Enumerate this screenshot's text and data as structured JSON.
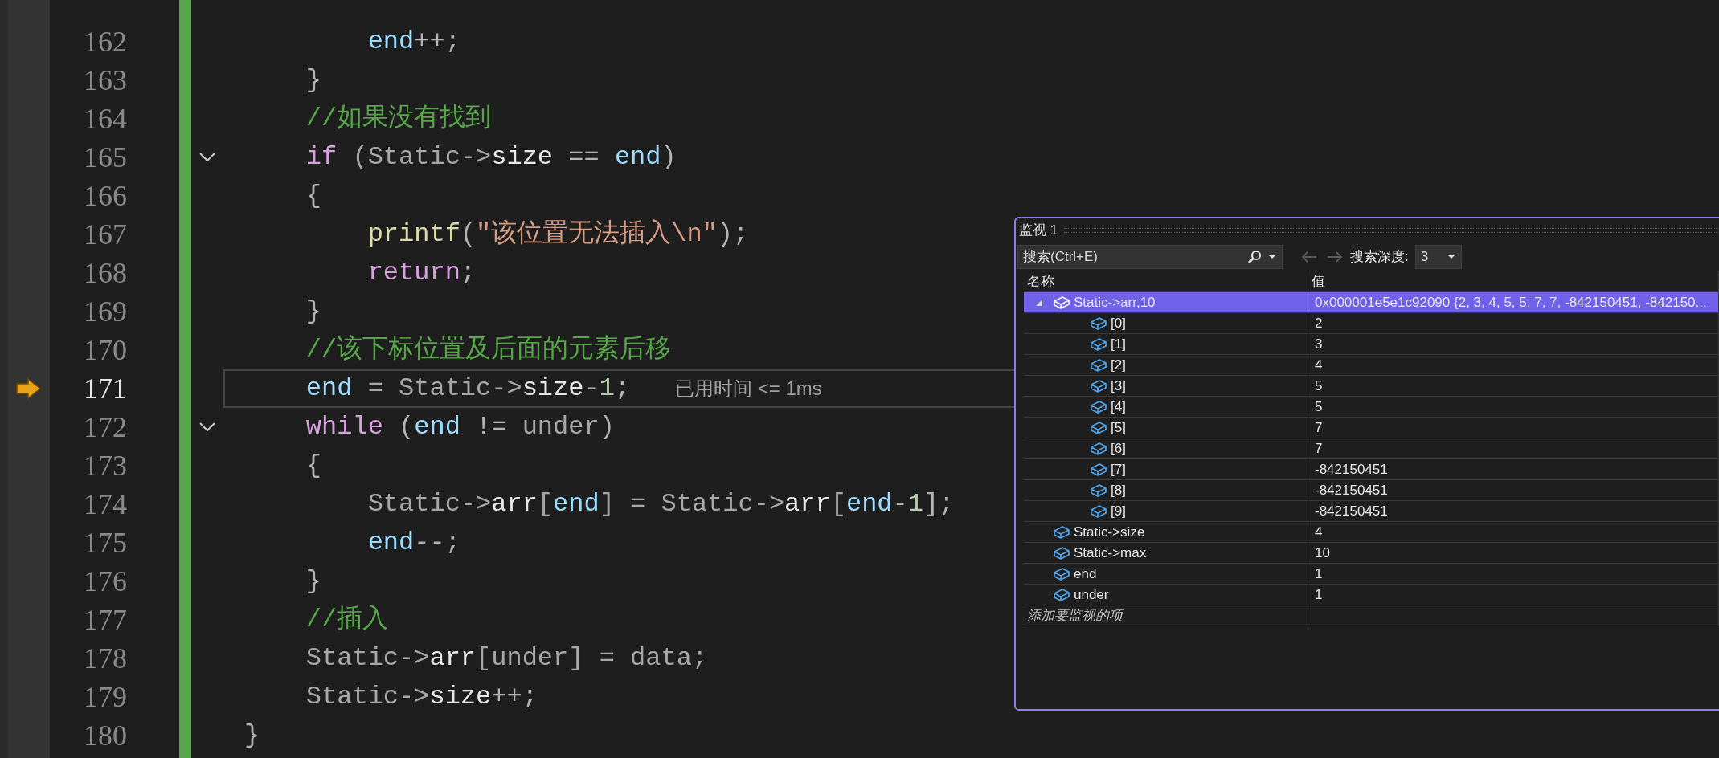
{
  "editor": {
    "lines": [
      {
        "number": "162",
        "current": false,
        "foldable": false,
        "tokens": [
          {
            "text": "        end",
            "kind": "var"
          },
          {
            "text": "++;",
            "kind": "punct"
          }
        ]
      },
      {
        "number": "163",
        "current": false,
        "foldable": false,
        "tokens": [
          {
            "text": "    }",
            "kind": "punct"
          }
        ]
      },
      {
        "number": "164",
        "current": false,
        "foldable": false,
        "tokens": [
          {
            "text": "    //如果没有找到",
            "kind": "comment"
          }
        ]
      },
      {
        "number": "165",
        "current": false,
        "foldable": true,
        "tokens": [
          {
            "text": "    if",
            "kind": "keyword"
          },
          {
            "text": " (Static->",
            "kind": "param"
          },
          {
            "text": "size",
            "kind": "field"
          },
          {
            "text": " == ",
            "kind": "punct"
          },
          {
            "text": "end",
            "kind": "var"
          },
          {
            "text": ")",
            "kind": "punct"
          }
        ]
      },
      {
        "number": "166",
        "current": false,
        "foldable": false,
        "tokens": [
          {
            "text": "    {",
            "kind": "punct"
          }
        ]
      },
      {
        "number": "167",
        "current": false,
        "foldable": false,
        "tokens": [
          {
            "text": "        printf",
            "kind": "function"
          },
          {
            "text": "(",
            "kind": "punct"
          },
          {
            "text": "\"该位置无法插入\\n\"",
            "kind": "string"
          },
          {
            "text": ");",
            "kind": "punct"
          }
        ]
      },
      {
        "number": "168",
        "current": false,
        "foldable": false,
        "tokens": [
          {
            "text": "        return",
            "kind": "keyword"
          },
          {
            "text": ";",
            "kind": "punct"
          }
        ]
      },
      {
        "number": "169",
        "current": false,
        "foldable": false,
        "tokens": [
          {
            "text": "    }",
            "kind": "punct"
          }
        ]
      },
      {
        "number": "170",
        "current": false,
        "foldable": false,
        "tokens": [
          {
            "text": "    //该下标位置及后面的元素后移",
            "kind": "comment"
          }
        ]
      },
      {
        "number": "171",
        "current": true,
        "foldable": false,
        "hint": "已用时间 <= 1ms",
        "tokens": [
          {
            "text": "    end",
            "kind": "var"
          },
          {
            "text": " = Static->",
            "kind": "param"
          },
          {
            "text": "size",
            "kind": "field"
          },
          {
            "text": "-",
            "kind": "punct"
          },
          {
            "text": "1",
            "kind": "number"
          },
          {
            "text": ";",
            "kind": "punct"
          }
        ]
      },
      {
        "number": "172",
        "current": false,
        "foldable": true,
        "tokens": [
          {
            "text": "    while",
            "kind": "keyword"
          },
          {
            "text": " (",
            "kind": "punct"
          },
          {
            "text": "end",
            "kind": "var"
          },
          {
            "text": " != ",
            "kind": "punct"
          },
          {
            "text": "under",
            "kind": "param"
          },
          {
            "text": ")",
            "kind": "punct"
          }
        ]
      },
      {
        "number": "173",
        "current": false,
        "foldable": false,
        "tokens": [
          {
            "text": "    {",
            "kind": "punct"
          }
        ]
      },
      {
        "number": "174",
        "current": false,
        "foldable": false,
        "tokens": [
          {
            "text": "        Static->",
            "kind": "param"
          },
          {
            "text": "arr",
            "kind": "field"
          },
          {
            "text": "[",
            "kind": "param"
          },
          {
            "text": "end",
            "kind": "var"
          },
          {
            "text": "] = Static->",
            "kind": "param"
          },
          {
            "text": "arr",
            "kind": "field"
          },
          {
            "text": "[",
            "kind": "param"
          },
          {
            "text": "end",
            "kind": "var"
          },
          {
            "text": "-",
            "kind": "punct"
          },
          {
            "text": "1",
            "kind": "number"
          },
          {
            "text": "];",
            "kind": "punct"
          }
        ]
      },
      {
        "number": "175",
        "current": false,
        "foldable": false,
        "tokens": [
          {
            "text": "        end",
            "kind": "var"
          },
          {
            "text": "--;",
            "kind": "punct"
          }
        ]
      },
      {
        "number": "176",
        "current": false,
        "foldable": false,
        "tokens": [
          {
            "text": "    }",
            "kind": "punct"
          }
        ]
      },
      {
        "number": "177",
        "current": false,
        "foldable": false,
        "tokens": [
          {
            "text": "    //插入",
            "kind": "comment"
          }
        ]
      },
      {
        "number": "178",
        "current": false,
        "foldable": false,
        "tokens": [
          {
            "text": "    Static->",
            "kind": "param"
          },
          {
            "text": "arr",
            "kind": "field"
          },
          {
            "text": "[under] = data;",
            "kind": "param"
          }
        ]
      },
      {
        "number": "179",
        "current": false,
        "foldable": false,
        "tokens": [
          {
            "text": "    Static->",
            "kind": "param"
          },
          {
            "text": "size",
            "kind": "field"
          },
          {
            "text": "++;",
            "kind": "punct"
          }
        ]
      },
      {
        "number": "180",
        "current": false,
        "foldable": false,
        "tokens": [
          {
            "text": "}",
            "kind": "punct"
          }
        ]
      }
    ]
  },
  "watch": {
    "title": "监视 1",
    "search": {
      "placeholder": "搜索(Ctrl+E)"
    },
    "depth_label": "搜索深度:",
    "depth_value": "3",
    "columns": [
      "名称",
      "值"
    ],
    "rows": [
      {
        "name": "Static->arr,10",
        "value": "0x000001e5e1c92090 {2, 3, 4, 5, 5, 7, 7, -842150451, -842150...",
        "selected": true,
        "expanded": true,
        "children": [
          {
            "name": "[0]",
            "value": "2",
            "selected": false
          },
          {
            "name": "[1]",
            "value": "3",
            "selected": false
          },
          {
            "name": "[2]",
            "value": "4",
            "selected": false
          },
          {
            "name": "[3]",
            "value": "5",
            "selected": false
          },
          {
            "name": "[4]",
            "value": "5",
            "selected": false
          },
          {
            "name": "[5]",
            "value": "7",
            "selected": false
          },
          {
            "name": "[6]",
            "value": "7",
            "selected": false
          },
          {
            "name": "[7]",
            "value": "-842150451",
            "selected": false
          },
          {
            "name": "[8]",
            "value": "-842150451",
            "selected": false
          },
          {
            "name": "[9]",
            "value": "-842150451",
            "selected": false
          }
        ]
      },
      {
        "name": "Static->size",
        "value": "4",
        "selected": false
      },
      {
        "name": "Static->max",
        "value": "10",
        "selected": false
      },
      {
        "name": "end",
        "value": "1",
        "selected": false
      },
      {
        "name": "under",
        "value": "1",
        "selected": false
      }
    ],
    "add_placeholder": "添加要监视的项"
  }
}
